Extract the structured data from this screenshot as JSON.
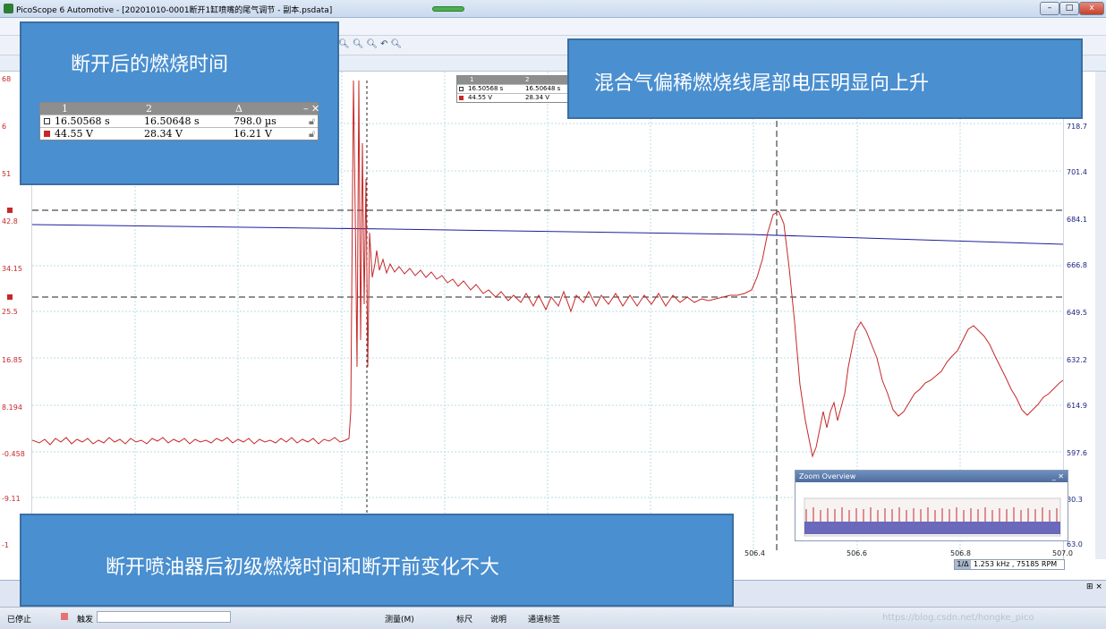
{
  "window": {
    "title": "PicoScope 6 Automotive - [20201010-0001断开1缸喷嘴的尾气调节 - 副本.psdata]",
    "controls": [
      "–",
      "□",
      "x"
    ]
  },
  "axes": {
    "left_ticks": [
      "68",
      "6",
      "51",
      "42.8",
      "34.15",
      "25.5",
      "16.85",
      "8.194",
      "-0.458",
      "-9.11",
      "-1"
    ],
    "right_ticks": [
      "718.7",
      "701.4",
      "684.1",
      "666.8",
      "649.5",
      "632.2",
      "614.9",
      "597.6",
      "80.3",
      "63.0"
    ],
    "bottom_ticks": [
      "506.4",
      "506.6",
      "506.8",
      "507.0"
    ]
  },
  "ruler_table_small": {
    "headers": [
      "1",
      "2"
    ],
    "row1": [
      "16.50568 s",
      "16.50648 s"
    ],
    "row2": [
      "44.55 V",
      "28.34 V"
    ]
  },
  "callout_top_left": {
    "text": "断开后的燃烧时间",
    "table": {
      "headers": [
        "1",
        "2",
        "Δ"
      ],
      "row1": [
        "16.50568 s",
        "16.50648 s",
        "798.0 µs"
      ],
      "row2": [
        "44.55 V",
        "28.34 V",
        "16.21 V"
      ]
    }
  },
  "callout_top_right": {
    "text": "混合气偏稀燃烧线尾部电压明显向上升"
  },
  "callout_bottom": {
    "text": "断开喷油器后初级燃烧时间和断开前变化不大"
  },
  "zoom_overview": {
    "title": "Zoom Overview",
    "close": "_ ✕"
  },
  "frequency_readout": {
    "text": "1.253 kHz , 75185 RPM"
  },
  "statusbar": {
    "stop_label": "已停止",
    "trigger_label": "触发",
    "measure_label": "测量(M)",
    "ruler_label": "标尺",
    "notes_label": "说明",
    "channel_label": "通道标签",
    "watermark": "https://blog.csdn.net/hongke_pico"
  },
  "colors": {
    "channel_a": "#c62828",
    "channel_b": "#1a237e",
    "callout_bg": "#4a8fd0"
  }
}
